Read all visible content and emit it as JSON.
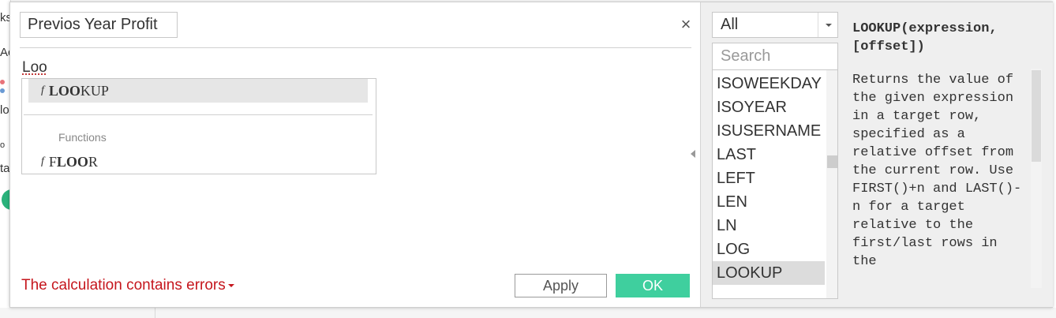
{
  "background": {
    "fragments": [
      "ks",
      "Ac",
      "lo",
      "o",
      "ta"
    ]
  },
  "dialog": {
    "calc_name": "Previos Year Profit",
    "close_glyph": "×",
    "editor_text": "Loo",
    "autocomplete": {
      "selected_item": {
        "match": "LOO",
        "rest": "KUP"
      },
      "section_header": "Functions",
      "other_item": {
        "before": "F",
        "match": "LOO",
        "rest": "R"
      },
      "fx_glyph": "f"
    },
    "error_message": "The calculation contains errors",
    "apply_label": "Apply",
    "ok_label": "OK"
  },
  "reference": {
    "category": "All",
    "search_placeholder": "Search",
    "functions": [
      "ISOWEEKDAY",
      "ISOYEAR",
      "ISUSERNAME",
      "LAST",
      "LEFT",
      "LEN",
      "LN",
      "LOG",
      "LOOKUP"
    ],
    "selected_function": "LOOKUP",
    "signature": "LOOKUP(expression, [offset])",
    "description": "Returns the value of the given expression in a target row, specified as a relative offset from the current row. Use FIRST()+n and LAST()-n for a target relative to the first/last rows in the"
  },
  "colors": {
    "ok_button": "#3fcf9e",
    "error_text": "#c5161d",
    "selection": "#e6e6e6"
  }
}
